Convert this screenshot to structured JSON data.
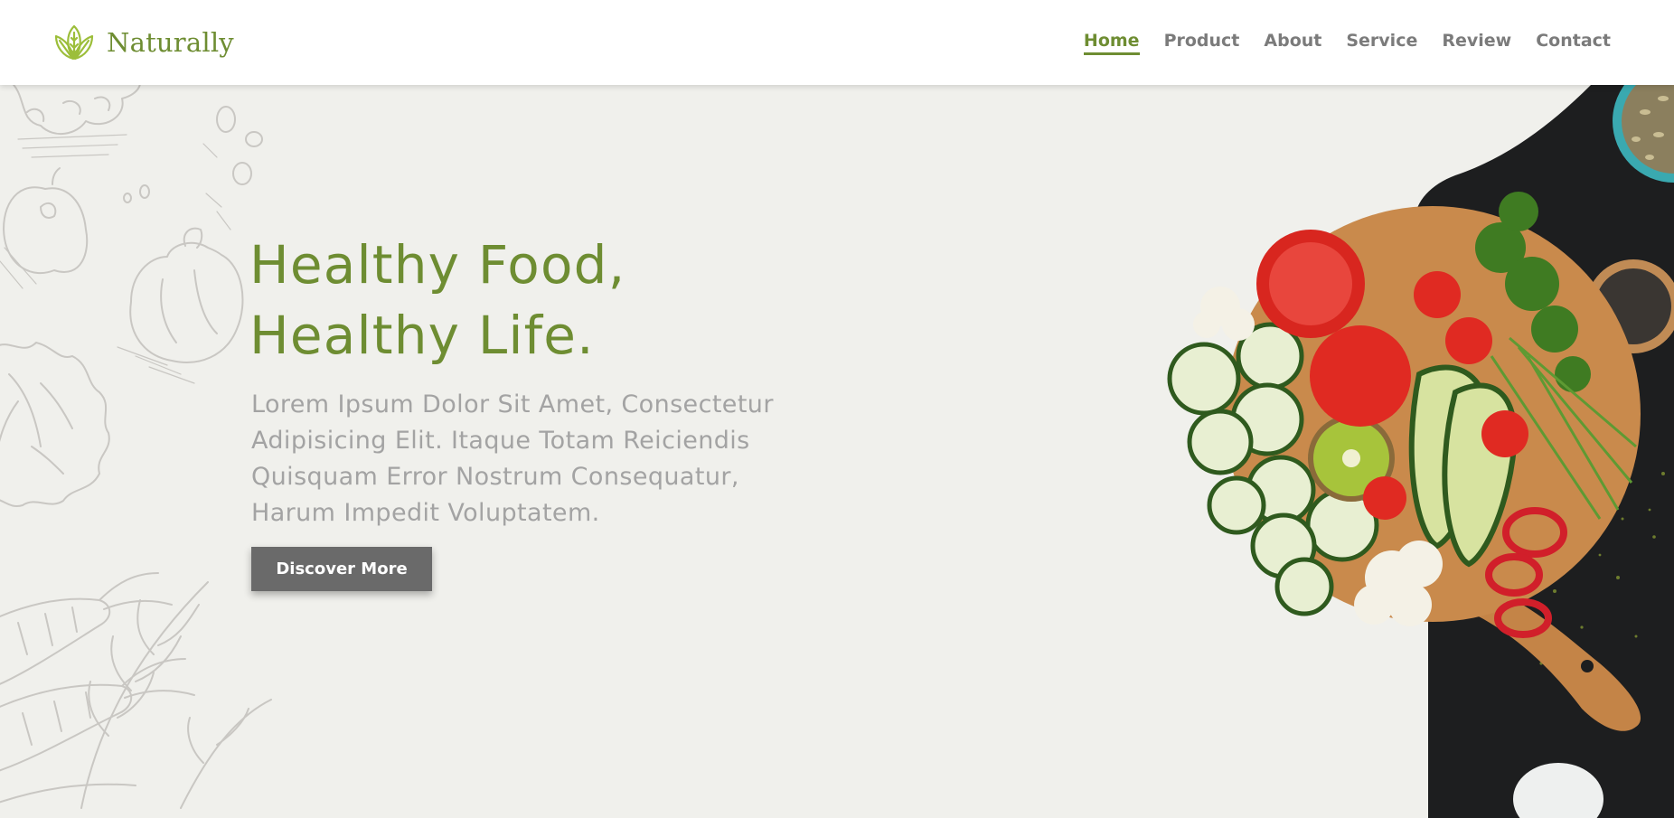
{
  "brand": {
    "name": "Naturally",
    "icon": "leaf-logo-icon",
    "color": "#6e8d32"
  },
  "nav": {
    "items": [
      {
        "label": "Home",
        "active": true
      },
      {
        "label": "Product",
        "active": false
      },
      {
        "label": "About",
        "active": false
      },
      {
        "label": "Service",
        "active": false
      },
      {
        "label": "Review",
        "active": false
      },
      {
        "label": "Contact",
        "active": false
      }
    ]
  },
  "hero": {
    "title_line1": "Healthy Food,",
    "title_line2": "Healthy Life.",
    "description": "Lorem Ipsum Dolor Sit Amet, Consectetur Adipisicing Elit. Itaque Totam Reiciendis Quisquam Error Nostrum Consequatur, Harum Impedit Voluptatem.",
    "button_label": "Discover More",
    "background_left": "vegetable-doodle-illustration",
    "image_right": "vegetables-on-cutting-board-image"
  },
  "colors": {
    "accent": "#6e8d32",
    "hero_background": "#f0f0ec",
    "button": "#6a6a6a",
    "muted_text": "#a3a3a3"
  }
}
